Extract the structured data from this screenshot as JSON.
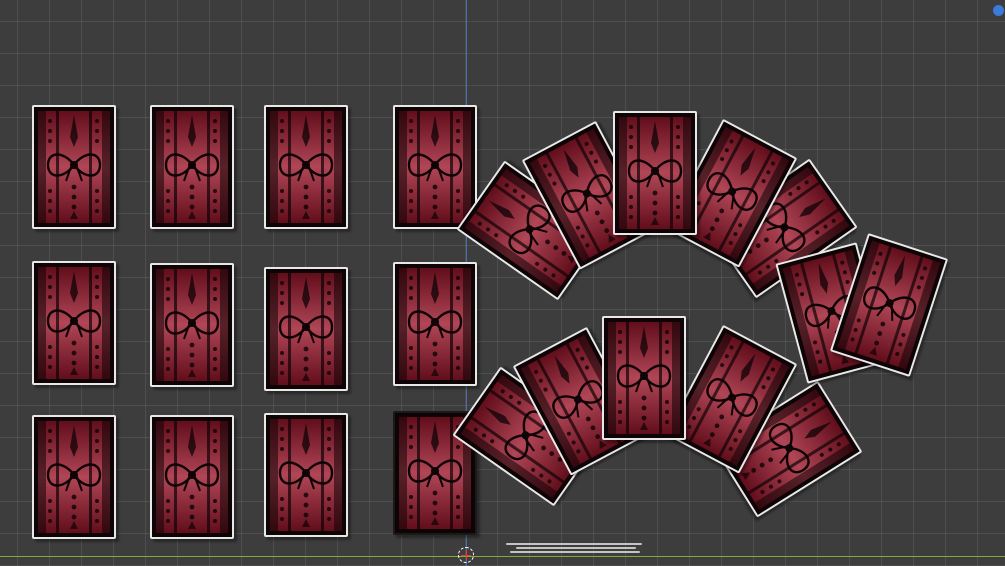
{
  "viewport": {
    "background": "#3d3d3d",
    "grid": true,
    "axis_colors": {
      "x": "#86a83a",
      "y": "#4a76c8"
    },
    "gizmo_color": "#3b7bd9"
  },
  "card_back": {
    "colors": {
      "base": "#0e0305",
      "stripe_dark": "#6b0f1e",
      "stripe_light": "#c24d5f",
      "border": "#e8e8e8"
    },
    "icon": "bow-icon"
  },
  "grid_cards_count": 12,
  "fan_groups": [
    {
      "name": "fan-top",
      "cards": 5
    },
    {
      "name": "fan-bottom",
      "cards": 5
    },
    {
      "name": "pair-right",
      "cards": 2
    }
  ]
}
